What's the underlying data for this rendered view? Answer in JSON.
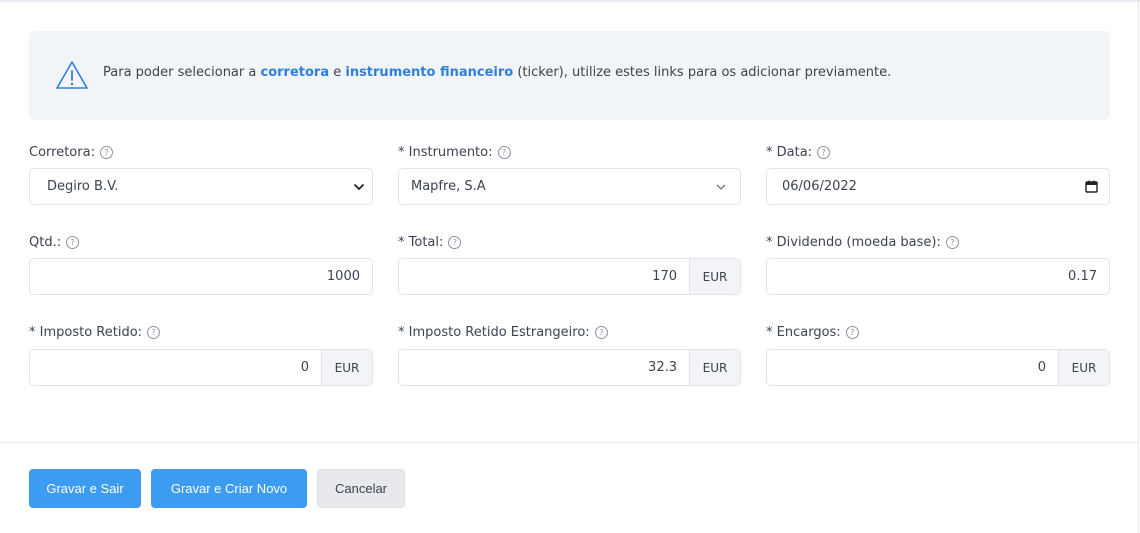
{
  "alert": {
    "text_before": "Para poder selecionar a ",
    "link_broker": "corretora",
    "text_and": " e ",
    "link_instrument": "instrumento financeiro",
    "text_after": " (ticker), utilize estes links para os adicionar previamente."
  },
  "help_glyph": "?",
  "fields": {
    "broker": {
      "label": "Corretora:",
      "value": "Degiro B.V."
    },
    "instrument": {
      "label": "* Instrumento:",
      "value": "Mapfre, S.A"
    },
    "date": {
      "label": "* Data:",
      "value": "06/06/2022"
    },
    "qty": {
      "label": "Qtd.:",
      "value": "1000"
    },
    "total": {
      "label": "* Total:",
      "value": "170",
      "currency": "EUR"
    },
    "dividend": {
      "label": "* Dividendo (moeda base):",
      "value": "0.17"
    },
    "withheld_tax": {
      "label": "* Imposto Retido:",
      "value": "0",
      "currency": "EUR"
    },
    "foreign_withheld_tax": {
      "label": "* Imposto Retido Estrangeiro:",
      "value": "32.3",
      "currency": "EUR"
    },
    "charges": {
      "label": "* Encargos:",
      "value": "0",
      "currency": "EUR"
    }
  },
  "buttons": {
    "save_exit": "Gravar e Sair",
    "save_new": "Gravar e Criar Novo",
    "cancel": "Cancelar"
  },
  "colors": {
    "primary": "#3c9cf2",
    "link": "#2e7fe0",
    "alert_bg": "#f2f5f8"
  }
}
